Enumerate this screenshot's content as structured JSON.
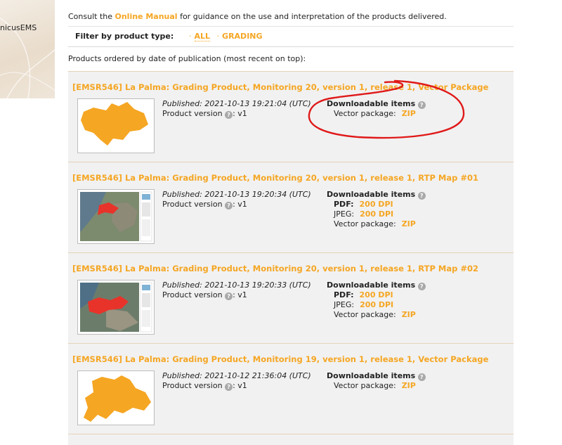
{
  "sidebar": {
    "label": "nicusEMS"
  },
  "intro": {
    "before": "Consult the ",
    "link": "Online Manual",
    "after": " for guidance on the use and interpretation of the products delivered."
  },
  "filter": {
    "label": "Filter by product type:",
    "options": [
      {
        "label": "ALL",
        "active": true
      },
      {
        "label": "GRADING",
        "active": false
      }
    ]
  },
  "order_note": "Products ordered by date of publication (most recent on top):",
  "labels": {
    "published": "Published:",
    "product_version": "Product version",
    "downloadable": "Downloadable items",
    "vector_package": "Vector package:",
    "pdf": "PDF:",
    "jpeg": "JPEG:",
    "help": "?"
  },
  "products": [
    {
      "title": "[EMSR546] La Palma: Grading Product, Monitoring 20, version 1, release 1, Vector Package",
      "published": "2021-10-13 19:21:04 (UTC)",
      "version": ": v1",
      "downloads": {
        "vector": "ZIP"
      }
    },
    {
      "title": "[EMSR546] La Palma: Grading Product, Monitoring 20, version 1, release 1, RTP Map #01",
      "published": "2021-10-13 19:20:34 (UTC)",
      "version": ": v1",
      "downloads": {
        "pdf": "200 DPI",
        "jpeg": "200 DPI",
        "vector": "ZIP"
      }
    },
    {
      "title": "[EMSR546] La Palma: Grading Product, Monitoring 20, version 1, release 1, RTP Map #02",
      "published": "2021-10-13 19:20:33 (UTC)",
      "version": ": v1",
      "downloads": {
        "pdf": "200 DPI",
        "jpeg": "200 DPI",
        "vector": "ZIP"
      }
    },
    {
      "title": "[EMSR546] La Palma: Grading Product, Monitoring 19, version 1, release 1, Vector Package",
      "published": "2021-10-12 21:36:04 (UTC)",
      "version": ": v1",
      "downloads": {
        "vector": "ZIP"
      }
    }
  ],
  "colors": {
    "accent": "#f5a623",
    "annotation": "#e01919",
    "map_red": "#e8332a"
  }
}
